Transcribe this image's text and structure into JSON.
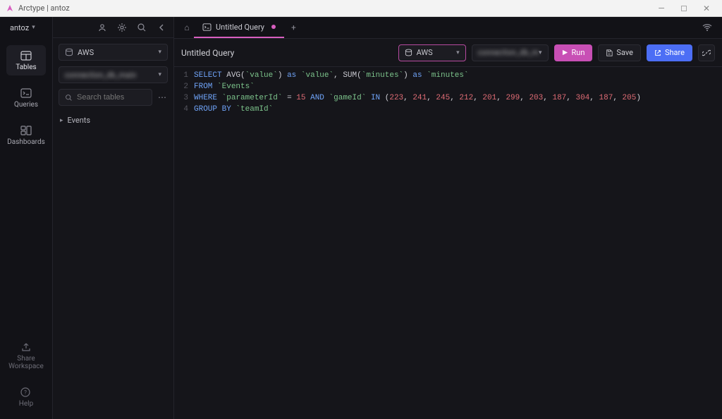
{
  "window": {
    "title": "Arctype | antoz"
  },
  "workspace": {
    "name": "antoz"
  },
  "nav": {
    "items": [
      {
        "label": "Tables"
      },
      {
        "label": "Queries"
      },
      {
        "label": "Dashboards"
      }
    ],
    "bottom": [
      {
        "label": "Share Workspace"
      },
      {
        "label": "Help"
      }
    ]
  },
  "sidebar": {
    "db_select": {
      "label": "AWS"
    },
    "conn_select": {
      "label": "connection_db_main"
    },
    "search_placeholder": "Search tables",
    "tree": [
      {
        "label": "Events"
      }
    ]
  },
  "tabs": {
    "items": [
      {
        "label": "Untitled Query",
        "dirty": true
      }
    ]
  },
  "toolbar": {
    "query_title": "Untitled Query",
    "db_select": "AWS",
    "conn_select": "connection_db_m",
    "run_label": "Run",
    "save_label": "Save",
    "share_label": "Share"
  },
  "editor": {
    "lines": [
      {
        "n": "1",
        "tokens": [
          [
            "kw",
            "SELECT"
          ],
          [
            "sp",
            " "
          ],
          [
            "fn",
            "AVG"
          ],
          [
            "plain",
            "("
          ],
          [
            "str",
            "`value`"
          ],
          [
            "plain",
            ")"
          ],
          [
            "sp",
            " "
          ],
          [
            "op",
            "as"
          ],
          [
            "sp",
            " "
          ],
          [
            "str",
            "`value`"
          ],
          [
            "plain",
            ","
          ],
          [
            "sp",
            " "
          ],
          [
            "fn",
            "SUM"
          ],
          [
            "plain",
            "("
          ],
          [
            "str",
            "`minutes`"
          ],
          [
            "plain",
            ")"
          ],
          [
            "sp",
            " "
          ],
          [
            "op",
            "as"
          ],
          [
            "sp",
            " "
          ],
          [
            "str",
            "`minutes`"
          ]
        ]
      },
      {
        "n": "2",
        "tokens": [
          [
            "kw",
            "FROM"
          ],
          [
            "sp",
            " "
          ],
          [
            "str",
            "`Events`"
          ]
        ]
      },
      {
        "n": "3",
        "tokens": [
          [
            "kw",
            "WHERE"
          ],
          [
            "sp",
            " "
          ],
          [
            "str",
            "`parameterId`"
          ],
          [
            "sp",
            " "
          ],
          [
            "plain",
            "="
          ],
          [
            "sp",
            " "
          ],
          [
            "num",
            "15"
          ],
          [
            "sp",
            " "
          ],
          [
            "kw",
            "AND"
          ],
          [
            "sp",
            " "
          ],
          [
            "str",
            "`gameId`"
          ],
          [
            "sp",
            " "
          ],
          [
            "kw",
            "IN"
          ],
          [
            "sp",
            " "
          ],
          [
            "plain",
            "("
          ],
          [
            "num",
            "223"
          ],
          [
            "plain",
            ", "
          ],
          [
            "num",
            "241"
          ],
          [
            "plain",
            ", "
          ],
          [
            "num",
            "245"
          ],
          [
            "plain",
            ", "
          ],
          [
            "num",
            "212"
          ],
          [
            "plain",
            ", "
          ],
          [
            "num",
            "201"
          ],
          [
            "plain",
            ", "
          ],
          [
            "num",
            "299"
          ],
          [
            "plain",
            ", "
          ],
          [
            "num",
            "203"
          ],
          [
            "plain",
            ", "
          ],
          [
            "num",
            "187"
          ],
          [
            "plain",
            ", "
          ],
          [
            "num",
            "304"
          ],
          [
            "plain",
            ", "
          ],
          [
            "num",
            "187"
          ],
          [
            "plain",
            ", "
          ],
          [
            "num",
            "205"
          ],
          [
            "plain",
            ")"
          ]
        ]
      },
      {
        "n": "4",
        "tokens": [
          [
            "kw",
            "GROUP BY"
          ],
          [
            "sp",
            " "
          ],
          [
            "str",
            "`teamId`"
          ]
        ]
      }
    ]
  }
}
